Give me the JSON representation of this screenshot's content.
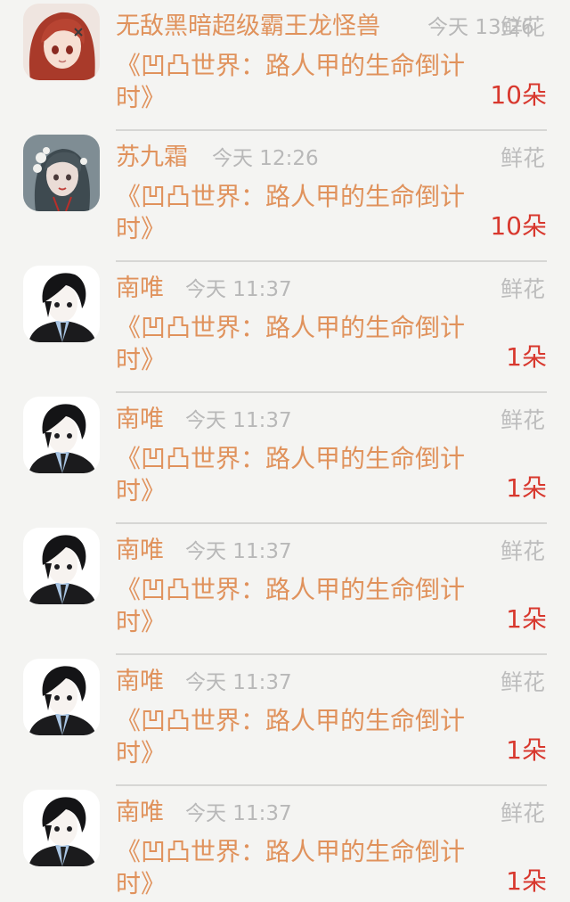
{
  "colors": {
    "background": "#f4f4f2",
    "name": "#e0925c",
    "book_title": "#e0925c",
    "time": "#b8b8b8",
    "gift_type": "#bdbdbd",
    "count": "#d8382e",
    "divider": "#d6d6d4"
  },
  "items": [
    {
      "name": "无敌黑暗超级霸王龙怪兽",
      "time": "今天 13:26",
      "gift_type": "鲜花",
      "book_title": "《凹凸世界：路人甲的生命倒计时》",
      "count": "10朵",
      "avatar": "red-hair-girl-avatar"
    },
    {
      "name": "苏九霜",
      "time": "今天 12:26",
      "gift_type": "鲜花",
      "book_title": "《凹凸世界：路人甲的生命倒计时》",
      "count": "10朵",
      "avatar": "flower-girl-avatar"
    },
    {
      "name": "南唯",
      "time": "今天 11:37",
      "gift_type": "鲜花",
      "book_title": "《凹凸世界：路人甲的生命倒计时》",
      "count": "1朵",
      "avatar": "dark-hair-boy-avatar"
    },
    {
      "name": "南唯",
      "time": "今天 11:37",
      "gift_type": "鲜花",
      "book_title": "《凹凸世界：路人甲的生命倒计时》",
      "count": "1朵",
      "avatar": "dark-hair-boy-avatar"
    },
    {
      "name": "南唯",
      "time": "今天 11:37",
      "gift_type": "鲜花",
      "book_title": "《凹凸世界：路人甲的生命倒计时》",
      "count": "1朵",
      "avatar": "dark-hair-boy-avatar"
    },
    {
      "name": "南唯",
      "time": "今天 11:37",
      "gift_type": "鲜花",
      "book_title": "《凹凸世界：路人甲的生命倒计时》",
      "count": "1朵",
      "avatar": "dark-hair-boy-avatar"
    },
    {
      "name": "南唯",
      "time": "今天 11:37",
      "gift_type": "鲜花",
      "book_title": "《凹凸世界：路人甲的生命倒计时》",
      "count": "1朵",
      "avatar": "dark-hair-boy-avatar"
    }
  ]
}
